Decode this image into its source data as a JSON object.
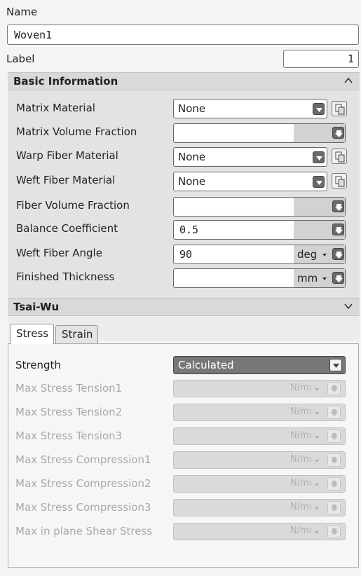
{
  "name": {
    "label": "Name",
    "value": "Woven1"
  },
  "label_row": {
    "label": "Label",
    "value": "1"
  },
  "basic_info": {
    "title": "Basic Information",
    "rows": [
      {
        "label": "Matrix Material",
        "value": "None",
        "unit": ""
      },
      {
        "label": "Matrix Volume Fraction",
        "value": "",
        "unit": ""
      },
      {
        "label": "Warp Fiber Material",
        "value": "None",
        "unit": ""
      },
      {
        "label": "Weft Fiber Material",
        "value": "None",
        "unit": ""
      },
      {
        "label": "Fiber Volume Fraction",
        "value": "",
        "unit": ""
      },
      {
        "label": "Balance Coefficient",
        "value": "0.5",
        "unit": ""
      },
      {
        "label": "Weft Fiber Angle",
        "value": "90",
        "unit": "deg"
      },
      {
        "label": "Finished Thickness",
        "value": "",
        "unit": "mm"
      }
    ]
  },
  "tsai_wu": {
    "title": "Tsai-Wu",
    "tabs": [
      "Stress",
      "Strain"
    ],
    "strength_label": "Strength",
    "strength_value": "Calculated",
    "disabled_rows": [
      {
        "label": "Max Stress Tension1",
        "unit": "N/mı"
      },
      {
        "label": "Max Stress Tension2",
        "unit": "N/mı"
      },
      {
        "label": "Max Stress Tension3",
        "unit": "N/mı"
      },
      {
        "label": "Max Stress Compression1",
        "unit": "N/mı"
      },
      {
        "label": "Max Stress Compression2",
        "unit": "N/mı"
      },
      {
        "label": "Max Stress Compression3",
        "unit": "N/mı"
      },
      {
        "label": "Max in plane Shear Stress",
        "unit": "N/mı"
      }
    ]
  },
  "icons": {
    "dropdown": "dropdown-arrow-icon",
    "library": "material-library-icon",
    "collapse": "chevron-up-icon",
    "expand": "chevron-down-icon"
  }
}
